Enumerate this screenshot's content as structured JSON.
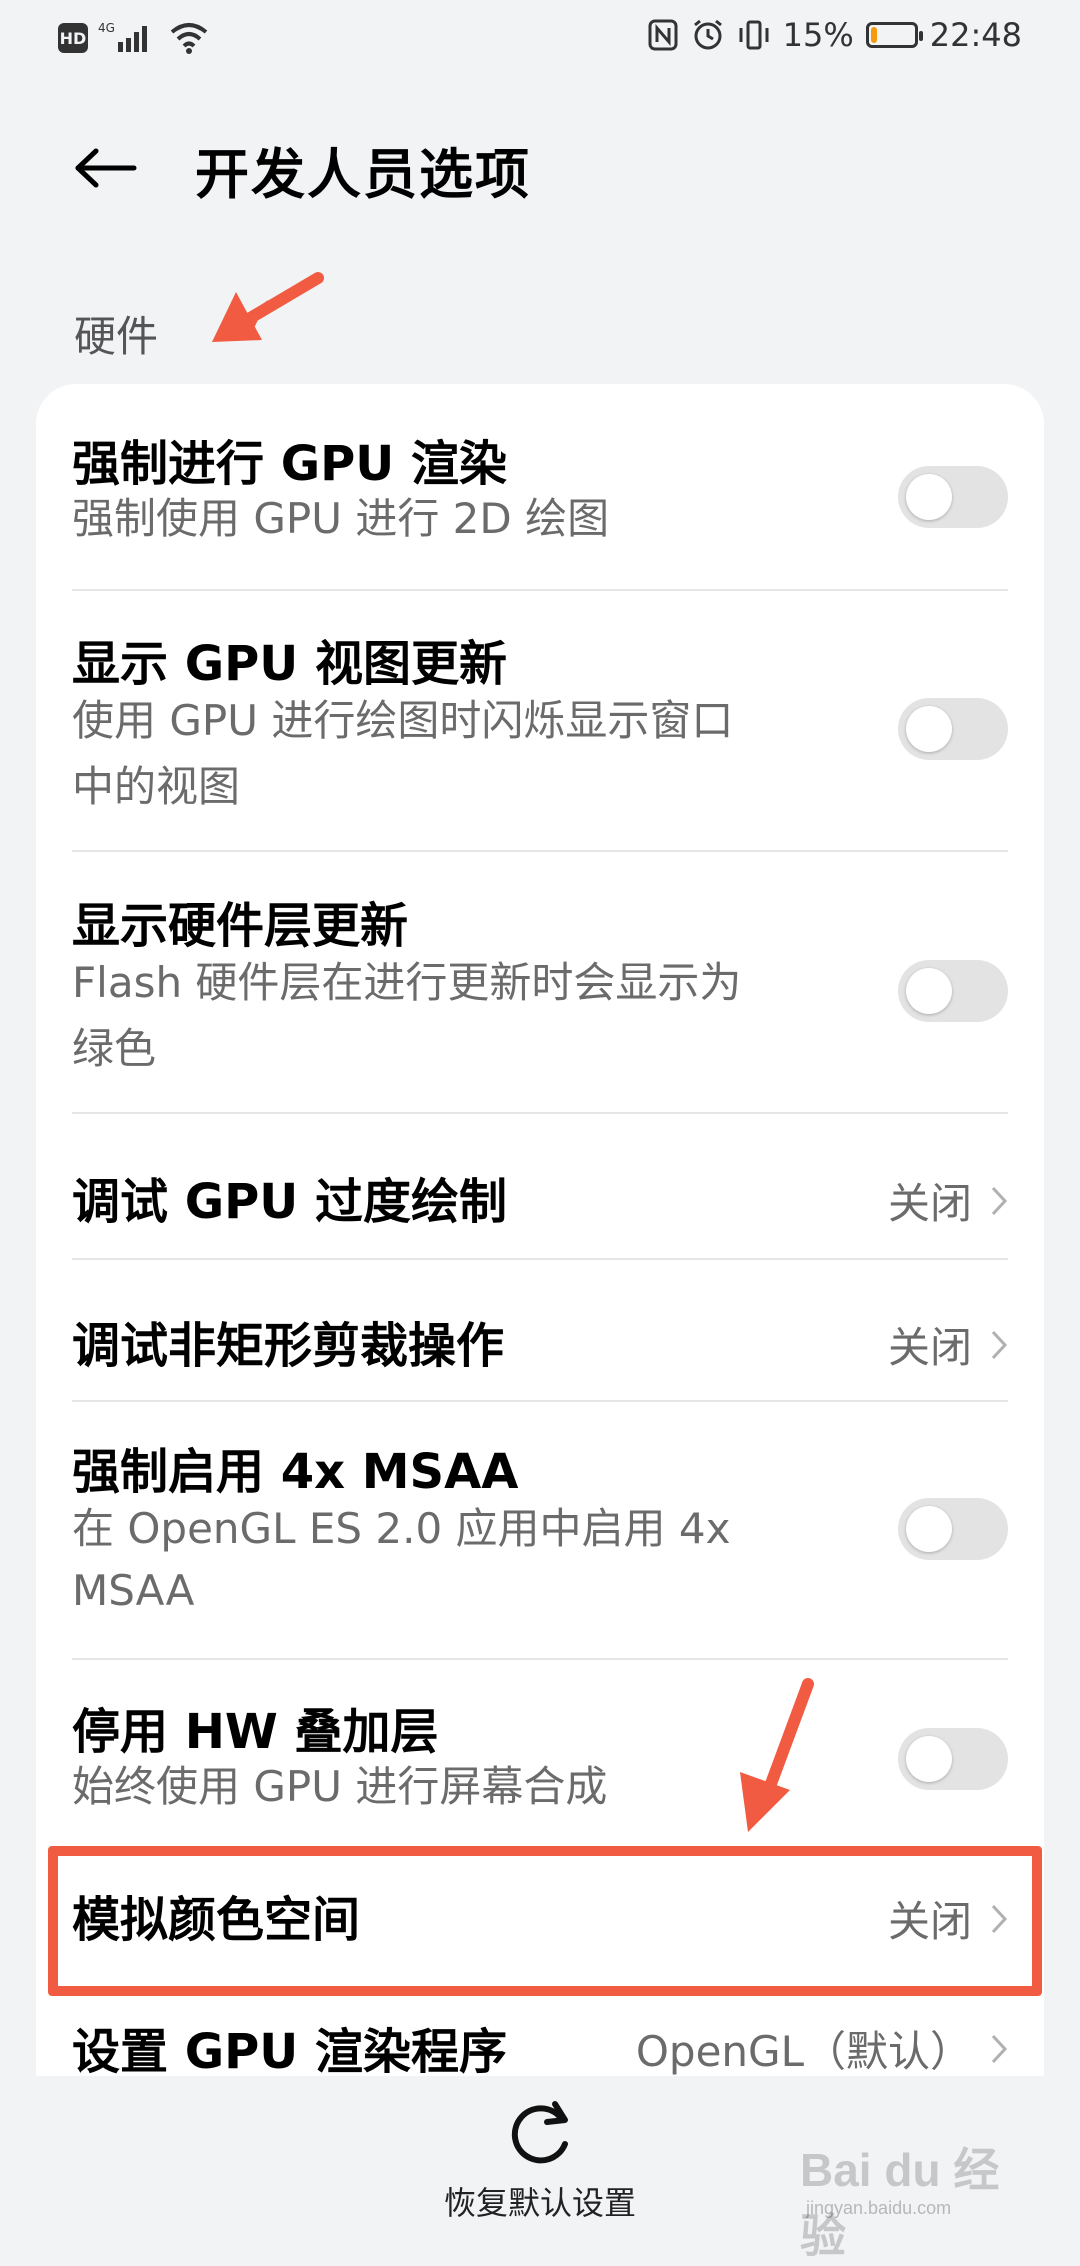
{
  "status_bar": {
    "left_badge": "HD",
    "network": "4G",
    "battery_percent": "15%",
    "battery_level": 0.15,
    "time": "22:48"
  },
  "header": {
    "title": "开发人员选项"
  },
  "section": {
    "label": "硬件"
  },
  "items": [
    {
      "title": "强制进行 GPU 渲染",
      "subtitle": "强制使用 GPU 进行 2D 绘图",
      "type": "toggle",
      "enabled": false
    },
    {
      "title": "显示 GPU 视图更新",
      "subtitle_line1": "使用 GPU 进行绘图时闪烁显示窗口",
      "subtitle_line2": "中的视图",
      "type": "toggle",
      "enabled": false
    },
    {
      "title": "显示硬件层更新",
      "subtitle_line1": "Flash 硬件层在进行更新时会显示为",
      "subtitle_line2": "绿色",
      "type": "toggle",
      "enabled": false
    },
    {
      "title": "调试 GPU 过度绘制",
      "value": "关闭",
      "type": "select"
    },
    {
      "title": "调试非矩形剪裁操作",
      "value": "关闭",
      "type": "select"
    },
    {
      "title": "强制启用 4x MSAA",
      "subtitle_line1": "在 OpenGL ES 2.0 应用中启用 4x",
      "subtitle_line2": "MSAA",
      "type": "toggle",
      "enabled": false
    },
    {
      "title": "停用 HW 叠加层",
      "subtitle": "始终使用 GPU 进行屏幕合成",
      "type": "toggle",
      "enabled": false
    },
    {
      "title": "模拟颜色空间",
      "value": "关闭",
      "type": "select"
    },
    {
      "title": "设置 GPU 渲染程序",
      "value": "OpenGL（默认）",
      "type": "select"
    }
  ],
  "bottom": {
    "reset_label": "恢复默认设置"
  },
  "watermark": {
    "text": "Bai du 经验",
    "sub": "jingyan.baidu.com"
  },
  "colors": {
    "accent_red": "#f05b41",
    "toggle_off": "#e3e3e3",
    "battery_low": "#f59b0b"
  }
}
